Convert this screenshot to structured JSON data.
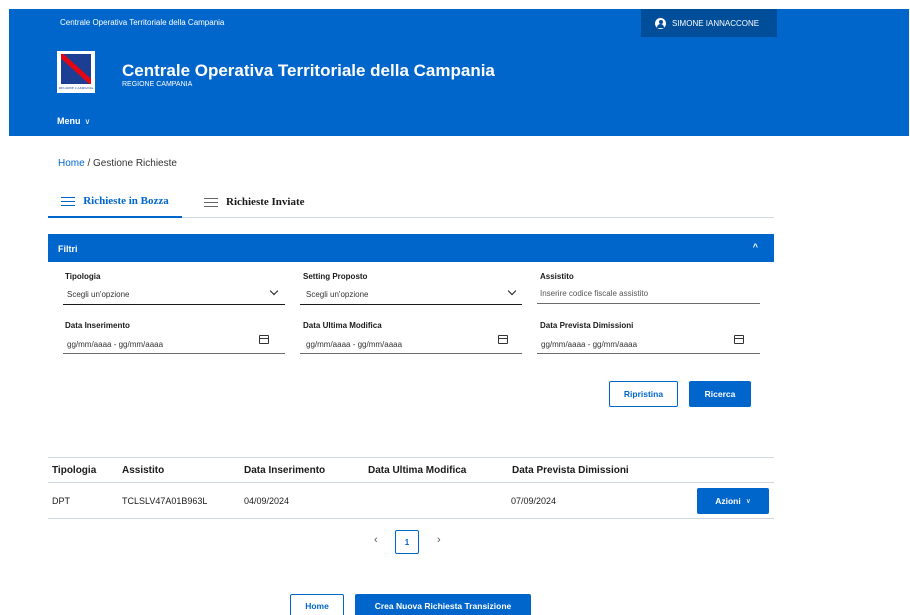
{
  "topbar": {
    "org_name": "Centrale Operativa Territoriale della Campania",
    "user_name": "SIMONE IANNACCONE"
  },
  "header": {
    "logo_text": "REGIONE CAMPANIA",
    "title": "Centrale Operativa Territoriale della Campania",
    "subtitle": "REGIONE CAMPANIA",
    "menu_label": "Menu",
    "menu_chevron": "∨"
  },
  "breadcrumb": {
    "home": "Home",
    "separator": "/",
    "current": "Gestione Richieste"
  },
  "tabs": [
    {
      "label": "Richieste in Bozza",
      "active": true
    },
    {
      "label": "Richieste Inviate",
      "active": false
    }
  ],
  "filters": {
    "title": "Filtri",
    "chevron": "^",
    "tipologia": {
      "label": "Tipologia",
      "value": "Scegli un'opzione"
    },
    "setting": {
      "label": "Setting Proposto",
      "value": "Scegli un'opzione"
    },
    "assistito": {
      "label": "Assistito",
      "placeholder": "Inserire codice fiscale assistito"
    },
    "data_inserimento": {
      "label": "Data Inserimento",
      "placeholder": "gg/mm/aaaa - gg/mm/aaaa"
    },
    "data_modifica": {
      "label": "Data Ultima Modifica",
      "placeholder": "gg/mm/aaaa - gg/mm/aaaa"
    },
    "data_dimissioni": {
      "label": "Data Prevista Dimissioni",
      "placeholder": "gg/mm/aaaa - gg/mm/aaaa"
    },
    "reset_label": "Ripristina",
    "search_label": "Ricerca"
  },
  "table": {
    "headers": [
      "Tipologia",
      "Assistito",
      "Data Inserimento",
      "Data Ultima Modifica",
      "Data Prevista Dimissioni"
    ],
    "rows": [
      {
        "tipologia": "DPT",
        "assistito": "TCLSLV47A01B963L",
        "data_inserimento": "04/09/2024",
        "data_modifica": "",
        "data_dimissioni": "07/09/2024",
        "action_label": "Azioni",
        "action_chevron": "∨"
      }
    ]
  },
  "pagination": {
    "prev": "‹",
    "page": "1",
    "next": "›"
  },
  "footer": {
    "home_label": "Home",
    "create_label": "Crea Nuova Richiesta Transizione"
  },
  "colors": {
    "primary": "#0066cc",
    "primary_dark": "#004d99"
  }
}
